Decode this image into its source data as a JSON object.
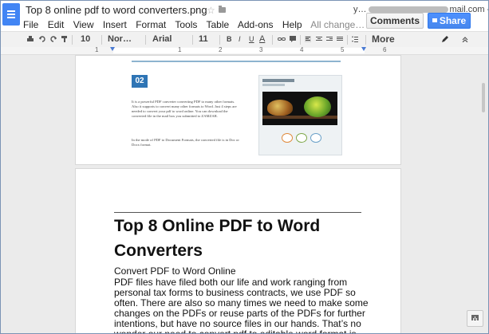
{
  "header": {
    "doc_title": "Top 8 online pdf to word converters.png",
    "account": "y…",
    "account_suffix": "mail.com -",
    "comments_label": "Comments",
    "share_label": "Share"
  },
  "menu": {
    "items": [
      "File",
      "Edit",
      "View",
      "Insert",
      "Format",
      "Tools",
      "Table",
      "Add-ons",
      "Help"
    ],
    "status": "All change…"
  },
  "toolbar": {
    "zoom": "10",
    "style": "Nor…",
    "font": "Arial",
    "size": "11",
    "bold": "B",
    "italic": "I",
    "underline": "U",
    "text_color": "A",
    "more_label": "More"
  },
  "ruler": {
    "numbers": [
      "1",
      "1",
      "2",
      "3",
      "4",
      "5",
      "6"
    ]
  },
  "page1": {
    "step_number": "02",
    "para1": "It is a powerful PDF converter converting PDF to many other formats. Also it supports to convert many other formats to Word. Just 4 steps are needed to convert your pdf to word online. You can download the converted file in the mail box you submitted to ZAMZAR.",
    "para2": "In the mode of PDF to Document Formats, the converted file is in Doc or Docx format.",
    "thumb_brand": "ZAMZAR"
  },
  "page2": {
    "title": "Top 8 Online PDF to Word Converters",
    "subtitle": "Convert PDF to Word Online",
    "body": "PDF files have filed both our life and work ranging from personal tax forms to business contracts, we use PDF so often. There are also so many times we need to make some changes on the PDFs or reuse parts of the PDFs for further intentions, but have no source files in our hands. That’s no wonder our need to convert pdf to editable word format is growing."
  },
  "colors": {
    "accent": "#4285f4",
    "share": "#4d90fe",
    "step_badge": "#2f75b5"
  }
}
